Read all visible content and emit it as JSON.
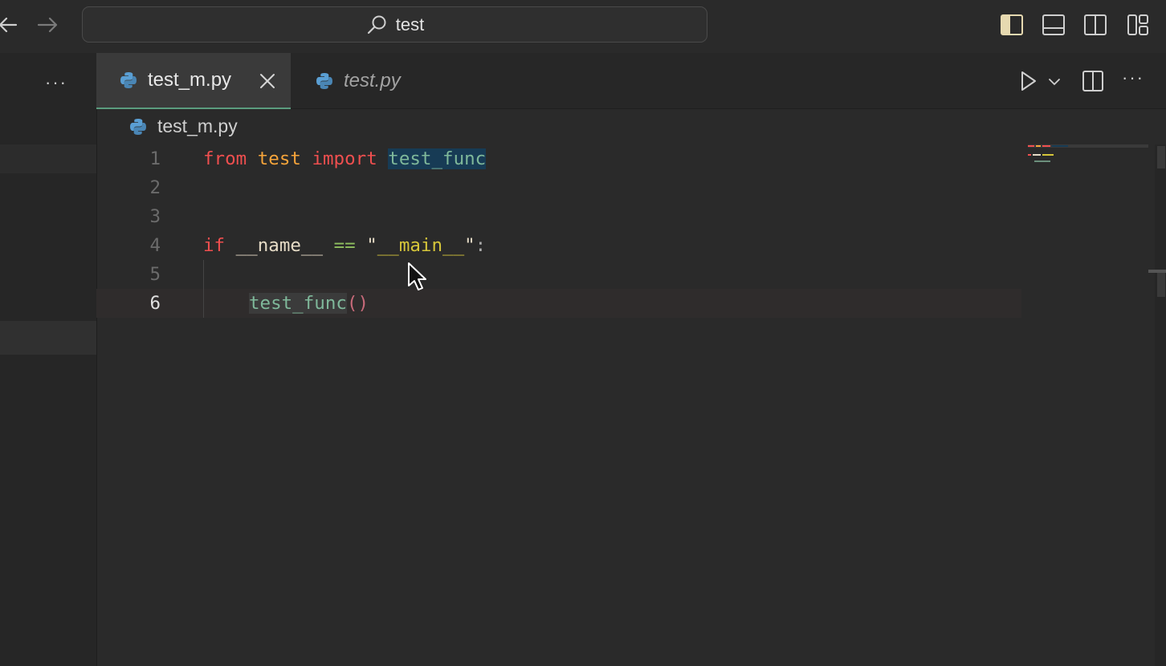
{
  "titlebar": {
    "search_text": "test",
    "icons": {
      "back": "arrow-left-icon",
      "forward": "arrow-right-icon",
      "search": "search-icon",
      "toggle_primary_sidebar": "sidebar-left-icon",
      "toggle_panel": "panel-bottom-icon",
      "toggle_secondary_sidebar": "sidebar-right-icon",
      "customize_layout": "layout-icon"
    }
  },
  "sidebar": {
    "more_label": "···"
  },
  "tabs": [
    {
      "label": "test_m.py",
      "active": true,
      "icon": "python-icon",
      "close_icon": "close-icon"
    },
    {
      "label": "test.py",
      "active": false,
      "preview": true,
      "icon": "python-icon"
    }
  ],
  "editor_actions": {
    "run": "play-icon",
    "run_menu": "chevron-down-icon",
    "split": "split-editor-icon",
    "more": "···"
  },
  "breadcrumb": {
    "file": "test_m.py",
    "icon": "python-icon"
  },
  "code": {
    "line_numbers": [
      "1",
      "2",
      "3",
      "4",
      "5",
      "6"
    ],
    "current_line": 6,
    "line1": {
      "from": "from",
      "module": "test",
      "import": "import",
      "name": "test_func"
    },
    "line4": {
      "if": "if",
      "var": "__name__",
      "op": "==",
      "q1": "\"",
      "str": "__main__",
      "q2": "\"",
      "colon": ":"
    },
    "line6": {
      "call": "test_func",
      "parens": "()"
    }
  },
  "colors": {
    "background": "#2a2a2a",
    "accent_tab_underline": "#5b9c7e",
    "keyword": "#ef4f4f",
    "module": "#f6a43a",
    "function": "#7fb89a",
    "string": "#d6c63a",
    "import_highlight": "#173b55"
  }
}
